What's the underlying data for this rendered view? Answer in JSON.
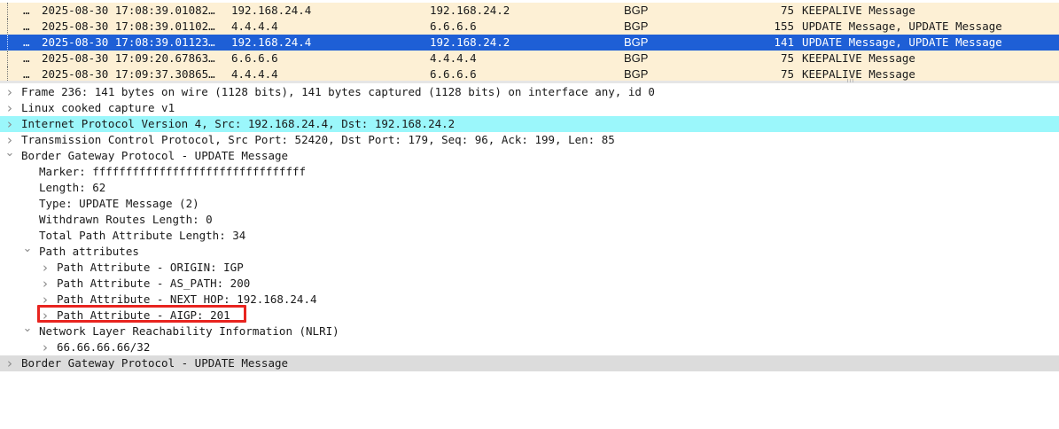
{
  "packet_list": {
    "rows": [
      {
        "no": "…",
        "time": "2025-08-30 17:08:39.01082…",
        "src": "192.168.24.4",
        "dst": "192.168.24.2",
        "proto": "BGP",
        "len": "75",
        "info": "KEEPALIVE Message",
        "selected": false
      },
      {
        "no": "…",
        "time": "2025-08-30 17:08:39.01102…",
        "src": "4.4.4.4",
        "dst": "6.6.6.6",
        "proto": "BGP",
        "len": "155",
        "info": "UPDATE Message, UPDATE Message",
        "selected": false
      },
      {
        "no": "…",
        "time": "2025-08-30 17:08:39.01123…",
        "src": "192.168.24.4",
        "dst": "192.168.24.2",
        "proto": "BGP",
        "len": "141",
        "info": "UPDATE Message, UPDATE Message",
        "selected": true
      },
      {
        "no": "…",
        "time": "2025-08-30 17:09:20.67863…",
        "src": "6.6.6.6",
        "dst": "4.4.4.4",
        "proto": "BGP",
        "len": "75",
        "info": "KEEPALIVE Message",
        "selected": false
      },
      {
        "no": "…",
        "time": "2025-08-30 17:09:37.30865…",
        "src": "4.4.4.4",
        "dst": "6.6.6.6",
        "proto": "BGP",
        "len": "75",
        "info": "KEEPALIVE Message",
        "selected": false
      }
    ]
  },
  "details": {
    "rows": [
      {
        "text": "Frame 236: 141 bytes on wire (1128 bits), 141 bytes captured (1128 bits) on interface any, id 0",
        "level": 0,
        "arrow": "collapsed",
        "highlight": "none"
      },
      {
        "text": "Linux cooked capture v1",
        "level": 0,
        "arrow": "collapsed",
        "highlight": "none"
      },
      {
        "text": "Internet Protocol Version 4, Src: 192.168.24.4, Dst: 192.168.24.2",
        "level": 0,
        "arrow": "collapsed",
        "highlight": "cyan"
      },
      {
        "text": "Transmission Control Protocol, Src Port: 52420, Dst Port: 179, Seq: 96, Ack: 199, Len: 85",
        "level": 0,
        "arrow": "collapsed",
        "highlight": "none"
      },
      {
        "text": "Border Gateway Protocol - UPDATE Message",
        "level": 0,
        "arrow": "expanded",
        "highlight": "none"
      },
      {
        "text": "Marker: ffffffffffffffffffffffffffffffff",
        "level": 1,
        "arrow": "none",
        "highlight": "none"
      },
      {
        "text": "Length: 62",
        "level": 1,
        "arrow": "none",
        "highlight": "none"
      },
      {
        "text": "Type: UPDATE Message (2)",
        "level": 1,
        "arrow": "none",
        "highlight": "none"
      },
      {
        "text": "Withdrawn Routes Length: 0",
        "level": 1,
        "arrow": "none",
        "highlight": "none"
      },
      {
        "text": "Total Path Attribute Length: 34",
        "level": 1,
        "arrow": "none",
        "highlight": "none"
      },
      {
        "text": "Path attributes",
        "level": 1,
        "arrow": "expanded",
        "highlight": "none"
      },
      {
        "text": "Path Attribute - ORIGIN: IGP",
        "level": 2,
        "arrow": "collapsed",
        "highlight": "none"
      },
      {
        "text": "Path Attribute - AS_PATH: 200",
        "level": 2,
        "arrow": "collapsed",
        "highlight": "none"
      },
      {
        "text": "Path Attribute - NEXT_HOP: 192.168.24.4",
        "level": 2,
        "arrow": "collapsed",
        "highlight": "none"
      },
      {
        "text": "Path Attribute - AIGP: 201",
        "level": 2,
        "arrow": "collapsed",
        "highlight": "none"
      },
      {
        "text": "Network Layer Reachability Information (NLRI)",
        "level": 1,
        "arrow": "expanded",
        "highlight": "none"
      },
      {
        "text": "66.66.66.66/32",
        "level": 2,
        "arrow": "collapsed",
        "highlight": "none"
      },
      {
        "text": "Border Gateway Protocol - UPDATE Message",
        "level": 0,
        "arrow": "collapsed",
        "highlight": "gray"
      }
    ]
  },
  "icons": {
    "collapsed": "chevron-right-icon",
    "expanded": "chevron-down-icon"
  },
  "colors": {
    "row_bg": "#fdf0d5",
    "selected_bg": "#1e5fd6",
    "ip_highlight": "#9bf7fb",
    "section_highlight": "#dcdcdc",
    "annotation_box": "#e8241f"
  }
}
